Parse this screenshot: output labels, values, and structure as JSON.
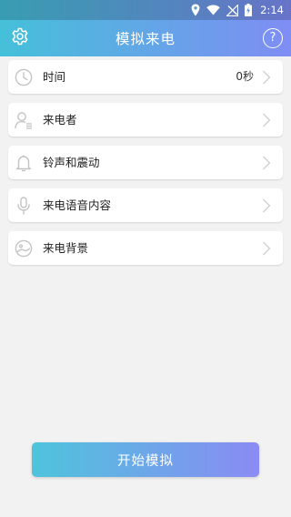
{
  "status_bar": {
    "time": "2:14",
    "icons": [
      "location-icon",
      "wifi-icon",
      "no-signal-icon",
      "battery-charging-icon"
    ]
  },
  "app_bar": {
    "title": "模拟来电",
    "left_icon": "gear-icon",
    "right_icon": "help-icon",
    "help_glyph": "?"
  },
  "settings": [
    {
      "label": "时间",
      "value": "0秒",
      "icon": "clock-icon"
    },
    {
      "label": "来电者",
      "value": "",
      "icon": "contact-icon"
    },
    {
      "label": "铃声和震动",
      "value": "",
      "icon": "bell-icon"
    },
    {
      "label": "来电语音内容",
      "value": "",
      "icon": "microphone-icon"
    },
    {
      "label": "来电背景",
      "value": "",
      "icon": "image-icon"
    }
  ],
  "start_button": {
    "label": "开始模拟"
  },
  "colors": {
    "gradient_start": "#45c0d9",
    "gradient_end": "#7f8df4",
    "background": "#f2f2f2",
    "icon_gray": "#c4c4c4"
  }
}
